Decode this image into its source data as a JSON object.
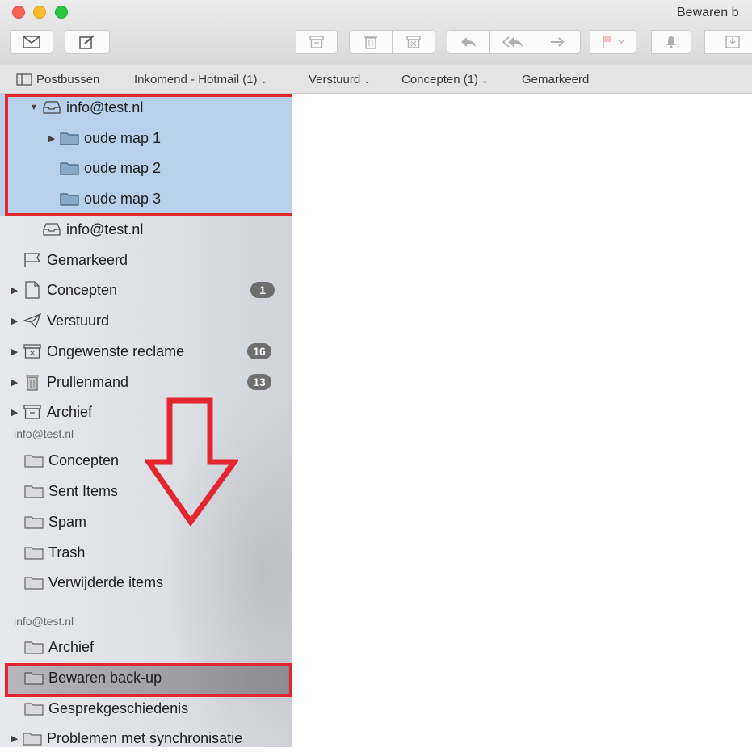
{
  "window": {
    "title": "Bewaren b"
  },
  "colors": {
    "accent_red": "#e3262f",
    "selection_blue": "#b8d0ea",
    "badge_grey": "#6e6e6e"
  },
  "toolbar": {
    "buttons": [
      "envelope-icon",
      "compose-icon",
      "archive-icon",
      "trash-icon",
      "junk-icon",
      "reply-icon",
      "reply-all-icon",
      "forward-icon",
      "flag-icon",
      "bell-icon",
      "move-icon"
    ]
  },
  "favorites": {
    "mailboxes": "Postbussen",
    "inbox": "Inkomend - Hotmail (1)",
    "sent": "Verstuurd",
    "drafts": "Concepten (1)",
    "flagged": "Gemarkeerd"
  },
  "sidebar": {
    "selected_account": "info@test.nl",
    "selected_folders": [
      "oude map 1",
      "oude map 2",
      "oude map 3"
    ],
    "account2": "info@test.nl",
    "items": [
      {
        "label": "Gemarkeerd",
        "badge": ""
      },
      {
        "label": "Concepten",
        "badge": "1"
      },
      {
        "label": "Verstuurd",
        "badge": ""
      },
      {
        "label": "Ongewenste reclame",
        "badge": "16"
      },
      {
        "label": "Prullenmand",
        "badge": "13"
      },
      {
        "label": "Archief",
        "badge": ""
      }
    ],
    "section1_header": "info@test.nl",
    "section1_folders": [
      "Concepten",
      "Sent Items",
      "Spam",
      "Trash",
      "Verwijderde items"
    ],
    "section2_header": "info@test.nl",
    "section2_folders": [
      "Archief",
      "Bewaren back-up",
      "Gesprekgeschiedenis",
      "Problemen met synchronisatie"
    ]
  }
}
